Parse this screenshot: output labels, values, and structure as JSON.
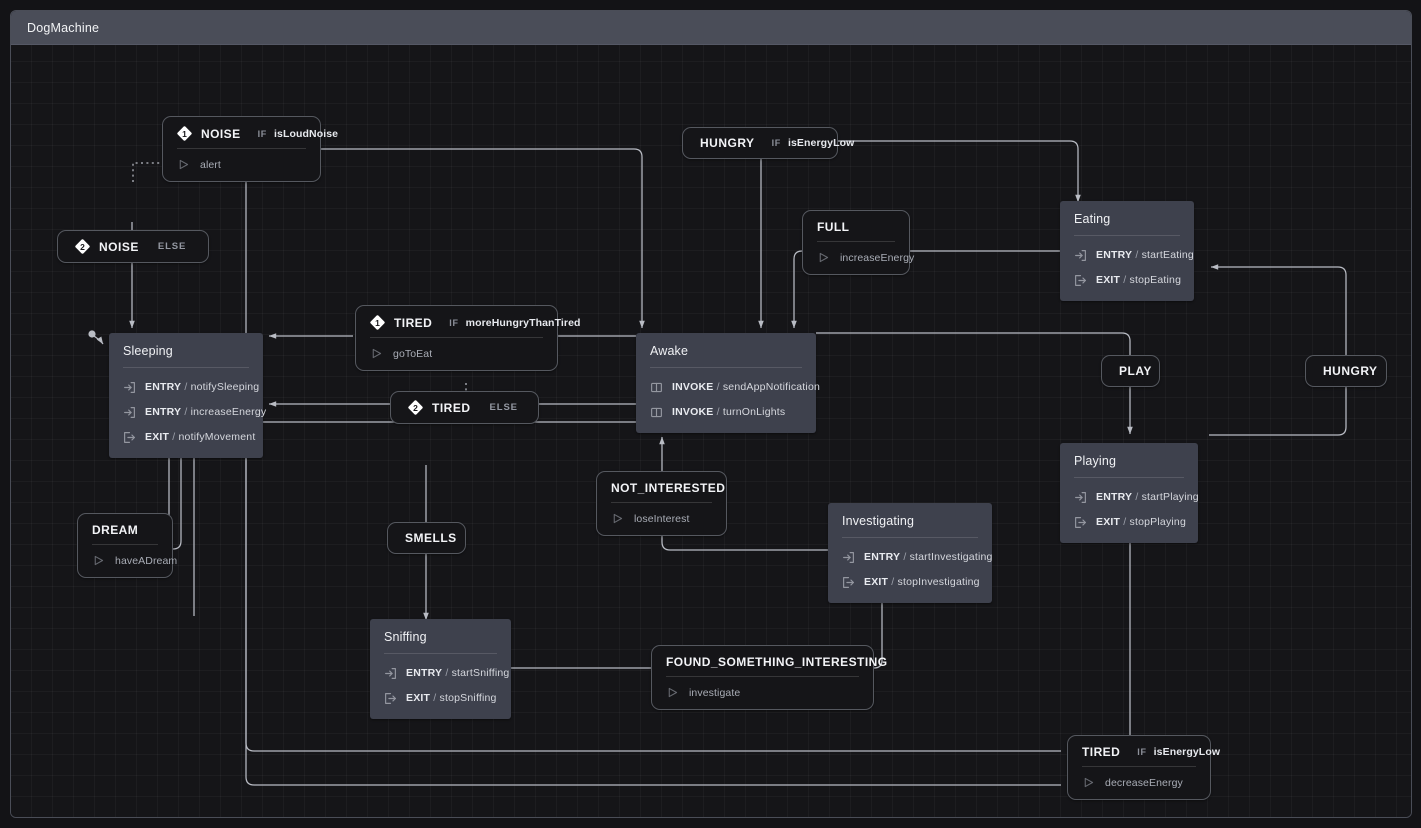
{
  "machine": {
    "title": "DogMachine"
  },
  "colors": {
    "header_bg": "#4a4d58",
    "canvas_bg": "#151518",
    "state_fill": "#3e414d",
    "event_fill": "#151518",
    "event_border": "#55585f",
    "edge": "#b9bcc4",
    "text": "#f0f1f4"
  },
  "labels": {
    "entry": "ENTRY",
    "exit": "EXIT",
    "invoke": "INVOKE",
    "separator": "/",
    "if": "IF",
    "else": "ELSE"
  },
  "states": [
    {
      "id": "sleeping",
      "name": "Sleeping",
      "initial": true,
      "actions": [
        {
          "kind": "ENTRY",
          "icon": "entry-arrow-icon",
          "name": "notifySleeping"
        },
        {
          "kind": "ENTRY",
          "icon": "entry-arrow-icon",
          "name": "increaseEnergy"
        },
        {
          "kind": "EXIT",
          "icon": "exit-arrow-icon",
          "name": "notifyMovement"
        }
      ]
    },
    {
      "id": "awake",
      "name": "Awake",
      "initial": false,
      "actions": [
        {
          "kind": "INVOKE",
          "icon": "invoke-book-icon",
          "name": "sendAppNotification"
        },
        {
          "kind": "INVOKE",
          "icon": "invoke-book-icon",
          "name": "turnOnLights"
        }
      ]
    },
    {
      "id": "eating",
      "name": "Eating",
      "initial": false,
      "actions": [
        {
          "kind": "ENTRY",
          "icon": "entry-arrow-icon",
          "name": "startEating"
        },
        {
          "kind": "EXIT",
          "icon": "exit-arrow-icon",
          "name": "stopEating"
        }
      ]
    },
    {
      "id": "playing",
      "name": "Playing",
      "initial": false,
      "actions": [
        {
          "kind": "ENTRY",
          "icon": "entry-arrow-icon",
          "name": "startPlaying"
        },
        {
          "kind": "EXIT",
          "icon": "exit-arrow-icon",
          "name": "stopPlaying"
        }
      ]
    },
    {
      "id": "investigating",
      "name": "Investigating",
      "initial": false,
      "actions": [
        {
          "kind": "ENTRY",
          "icon": "entry-arrow-icon",
          "name": "startInvestigating"
        },
        {
          "kind": "EXIT",
          "icon": "exit-arrow-icon",
          "name": "stopInvestigating"
        }
      ]
    },
    {
      "id": "sniffing",
      "name": "Sniffing",
      "initial": false,
      "actions": [
        {
          "kind": "ENTRY",
          "icon": "entry-arrow-icon",
          "name": "startSniffing"
        },
        {
          "kind": "EXIT",
          "icon": "exit-arrow-icon",
          "name": "stopSniffing"
        }
      ]
    }
  ],
  "transitions": [
    {
      "id": "noise-1",
      "event": "NOISE",
      "order": "1",
      "guard_kind": "IF",
      "guard": "isLoudNoise",
      "action": "alert"
    },
    {
      "id": "noise-2",
      "event": "NOISE",
      "order": "2",
      "guard_kind": "ELSE",
      "guard": "",
      "action": ""
    },
    {
      "id": "hungry-top",
      "event": "HUNGRY",
      "order": "",
      "guard_kind": "IF",
      "guard": "isEnergyLow",
      "action": ""
    },
    {
      "id": "full",
      "event": "FULL",
      "order": "",
      "guard_kind": "",
      "guard": "",
      "action": "increaseEnergy"
    },
    {
      "id": "tired-1",
      "event": "TIRED",
      "order": "1",
      "guard_kind": "IF",
      "guard": "moreHungryThanTired",
      "action": "goToEat"
    },
    {
      "id": "tired-2",
      "event": "TIRED",
      "order": "2",
      "guard_kind": "ELSE",
      "guard": "",
      "action": ""
    },
    {
      "id": "dream",
      "event": "DREAM",
      "order": "",
      "guard_kind": "",
      "guard": "",
      "action": "haveADream"
    },
    {
      "id": "not-interested",
      "event": "NOT_INTERESTED",
      "order": "",
      "guard_kind": "",
      "guard": "",
      "action": "loseInterest"
    },
    {
      "id": "smells",
      "event": "SMELLS",
      "order": "",
      "guard_kind": "",
      "guard": "",
      "action": ""
    },
    {
      "id": "play",
      "event": "PLAY",
      "order": "",
      "guard_kind": "",
      "guard": "",
      "action": ""
    },
    {
      "id": "hungry-right",
      "event": "HUNGRY",
      "order": "",
      "guard_kind": "",
      "guard": "",
      "action": ""
    },
    {
      "id": "found-something",
      "event": "FOUND_SOMETHING_INTERESTING",
      "order": "",
      "guard_kind": "",
      "guard": "",
      "action": "investigate"
    },
    {
      "id": "tired-bottom",
      "event": "TIRED",
      "order": "",
      "guard_kind": "IF",
      "guard": "isEnergyLow",
      "action": "decreaseEnergy"
    }
  ]
}
